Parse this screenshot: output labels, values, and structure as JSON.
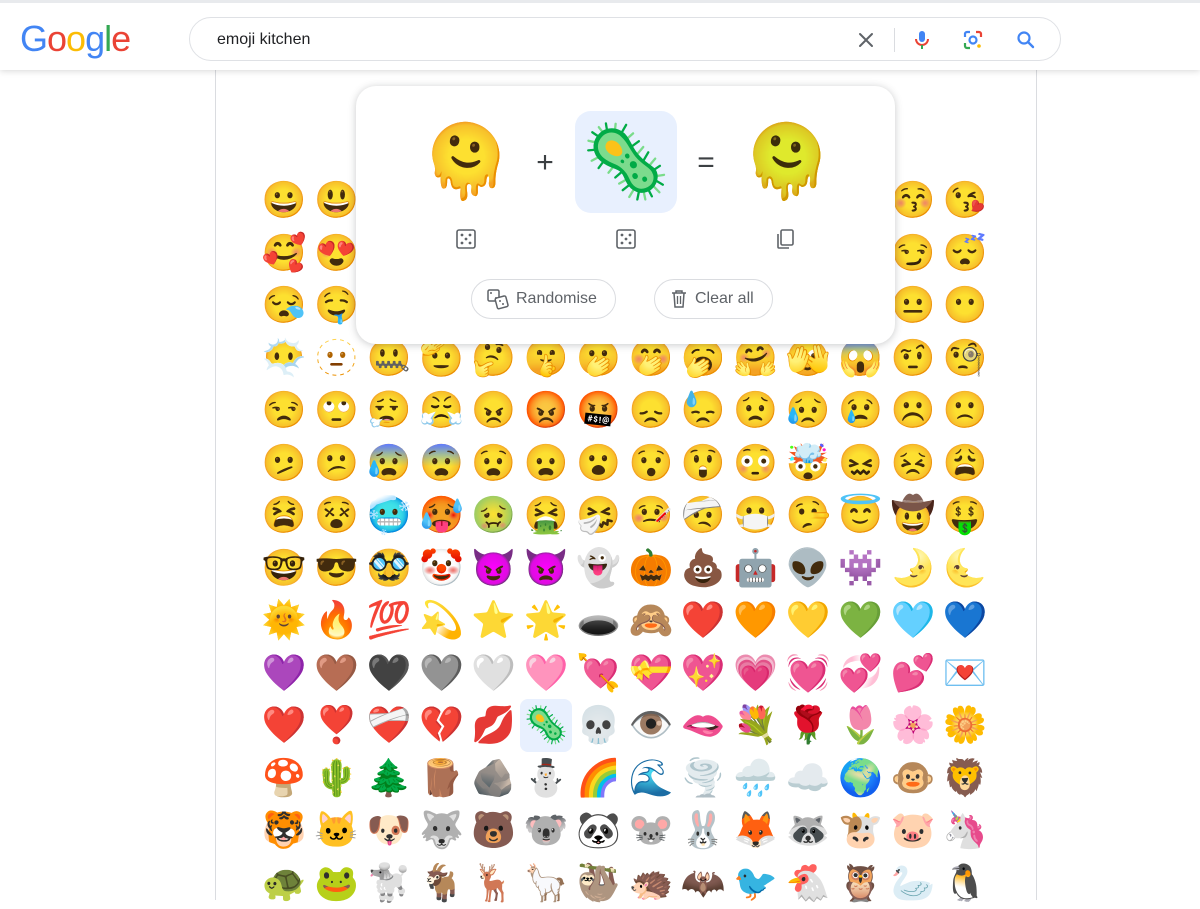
{
  "brand": {
    "letters": [
      {
        "ch": "G",
        "color": "#4285F4"
      },
      {
        "ch": "o",
        "color": "#EA4335"
      },
      {
        "ch": "o",
        "color": "#FBBC05"
      },
      {
        "ch": "g",
        "color": "#4285F4"
      },
      {
        "ch": "l",
        "color": "#34A853"
      },
      {
        "ch": "e",
        "color": "#EA4335"
      }
    ]
  },
  "search": {
    "query": "emoji kitchen",
    "icons": [
      "clear-icon",
      "mic-icon",
      "lens-icon",
      "search-icon"
    ]
  },
  "kitchen": {
    "left_emoji": "🫠",
    "right_emoji": "🦠",
    "result_emoji": "🫠",
    "plus": "+",
    "equals": "=",
    "randomise_label": "Randomise",
    "clear_label": "Clear all"
  },
  "grid": {
    "selected_index": 145,
    "emojis": [
      "😀",
      "😃",
      "😄",
      "😁",
      "😆",
      "😅",
      "😂",
      "🤣",
      "😭",
      "😉",
      "😗",
      "😙",
      "😚",
      "😘",
      "🥰",
      "😍",
      "🤩",
      "🥳",
      "🙃",
      "🙂",
      "🥲",
      "🥹",
      "☺️",
      "😊",
      "😌",
      "😇",
      "😏",
      "😴",
      "😪",
      "🤤",
      "😋",
      "😛",
      "😝",
      "😜",
      "🤪",
      "🥴",
      "😔",
      "🥺",
      "😬",
      "😑",
      "😐",
      "😶",
      "😶‍🌫️",
      "🫥",
      "🤐",
      "🫡",
      "🤔",
      "🤫",
      "🫢",
      "🤭",
      "🥱",
      "🤗",
      "🫣",
      "😱",
      "🤨",
      "🧐",
      "😒",
      "🙄",
      "😮‍💨",
      "😤",
      "😠",
      "😡",
      "🤬",
      "😞",
      "😓",
      "😟",
      "😥",
      "😢",
      "☹️",
      "🙁",
      "🫤",
      "😕",
      "😰",
      "😨",
      "😧",
      "😦",
      "😮",
      "😯",
      "😲",
      "😳",
      "🤯",
      "😖",
      "😣",
      "😩",
      "😫",
      "😵",
      "🥶",
      "🥵",
      "🤢",
      "🤮",
      "🤧",
      "🤒",
      "🤕",
      "😷",
      "🤥",
      "😇",
      "🤠",
      "🤑",
      "🤓",
      "😎",
      "🥸",
      "🤡",
      "😈",
      "👿",
      "👻",
      "🎃",
      "💩",
      "🤖",
      "👽",
      "👾",
      "🌛",
      "🌜",
      "🌞",
      "🔥",
      "💯",
      "💫",
      "⭐",
      "🌟",
      "🕳️",
      "🙈",
      "❤️",
      "🧡",
      "💛",
      "💚",
      "🩵",
      "💙",
      "💜",
      "🤎",
      "🖤",
      "🩶",
      "🤍",
      "🩷",
      "💘",
      "💝",
      "💖",
      "💗",
      "💓",
      "💞",
      "💕",
      "💌",
      "❤️",
      "❣️",
      "❤️‍🩹",
      "💔",
      "💋",
      "🦠",
      "💀",
      "👁️",
      "🫦",
      "💐",
      "🌹",
      "🌷",
      "🌸",
      "🌼",
      "🍄",
      "🌵",
      "🌲",
      "🪵",
      "🪨",
      "⛄",
      "🌈",
      "🌊",
      "🌪️",
      "🌧️",
      "☁️",
      "🌍",
      "🐵",
      "🦁",
      "🐯",
      "🐱",
      "🐶",
      "🐺",
      "🐻",
      "🐨",
      "🐼",
      "🐭",
      "🐰",
      "🦊",
      "🦝",
      "🐮",
      "🐷",
      "🦄",
      "🐢",
      "🐸",
      "🐩",
      "🐐",
      "🦌",
      "🦙",
      "🦥",
      "🦔",
      "🦇",
      "🐦",
      "🐔",
      "🦉",
      "🦢",
      "🐧"
    ]
  }
}
